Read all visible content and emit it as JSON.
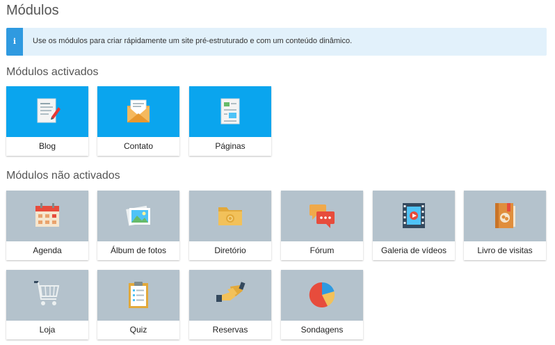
{
  "page": {
    "title": "Módulos",
    "info": "Use os módulos para criar rápidamente um site pré-estruturado e com um conteúdo dinâmico."
  },
  "sections": {
    "active_title": "Módulos activados",
    "inactive_title": "Módulos não activados"
  },
  "active_modules": [
    {
      "label": "Blog",
      "icon": "blog-document-icon"
    },
    {
      "label": "Contato",
      "icon": "envelope-icon"
    },
    {
      "label": "Páginas",
      "icon": "pages-icon"
    }
  ],
  "inactive_modules": [
    {
      "label": "Agenda",
      "icon": "calendar-icon"
    },
    {
      "label": "Álbum de fotos",
      "icon": "photos-icon"
    },
    {
      "label": "Diretório",
      "icon": "folder-icon"
    },
    {
      "label": "Fórum",
      "icon": "chat-bubbles-icon"
    },
    {
      "label": "Galeria de vídeos",
      "icon": "video-film-icon"
    },
    {
      "label": "Livro de visitas",
      "icon": "guestbook-icon"
    },
    {
      "label": "Loja",
      "icon": "shopping-cart-icon"
    },
    {
      "label": "Quiz",
      "icon": "clipboard-icon"
    },
    {
      "label": "Reservas",
      "icon": "handshake-icon"
    },
    {
      "label": "Sondagens",
      "icon": "pie-chart-icon"
    }
  ],
  "colors": {
    "active_tile": "#0aa5ee",
    "inactive_tile": "#b4c2cc",
    "info_background": "#e2f1fb",
    "info_accent": "#2f9ae0"
  }
}
